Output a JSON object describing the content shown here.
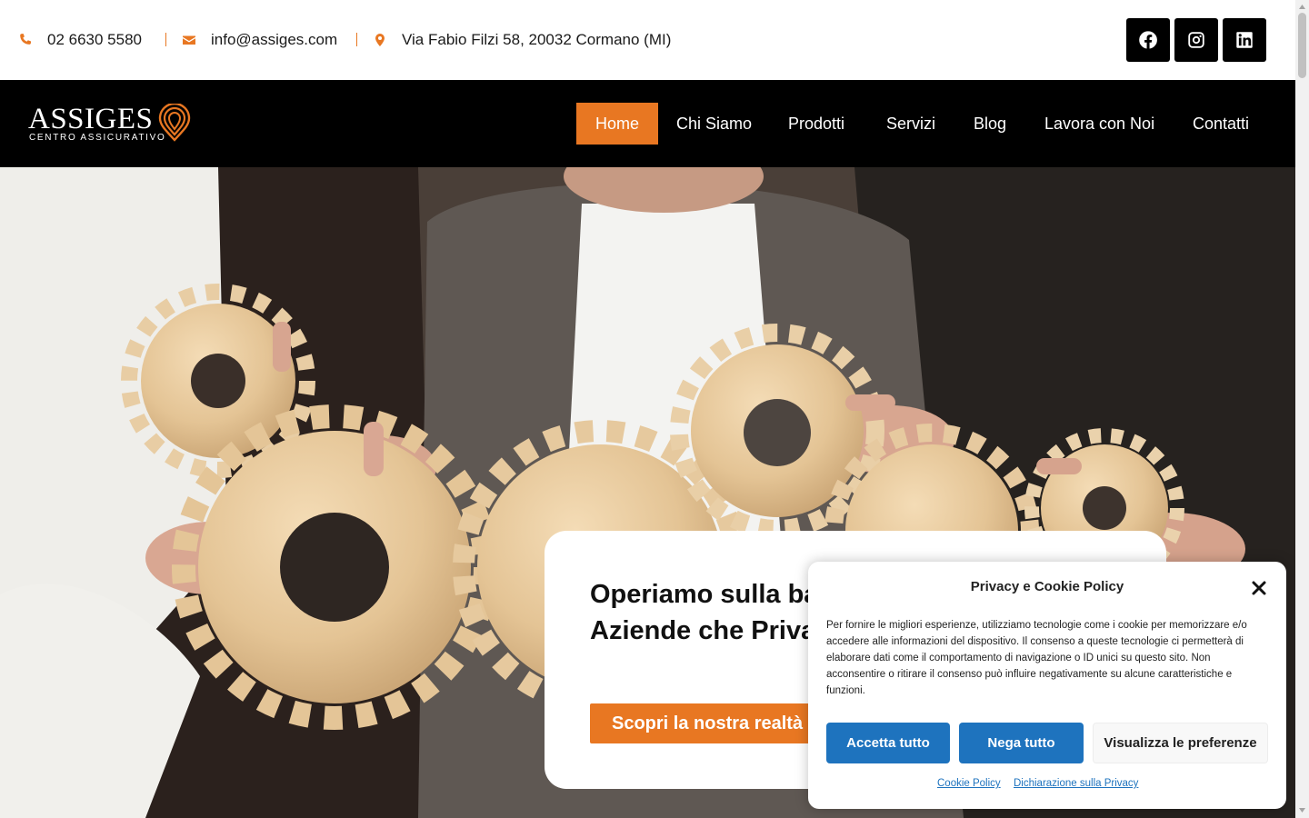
{
  "topbar": {
    "phone": "02 6630 5580",
    "email": "info@assiges.com",
    "address": "Via Fabio Filzi 58, 20032 Cormano (MI)",
    "icons": [
      "phone-icon",
      "envelope-icon",
      "map-marker-icon"
    ],
    "social": [
      "facebook-icon",
      "instagram-icon",
      "linkedin-icon"
    ]
  },
  "logo": {
    "word": "ASSIGES",
    "subtitle": "CENTRO ASSICURATIVO"
  },
  "nav": {
    "items": [
      {
        "label": "Home",
        "active": true
      },
      {
        "label": "Chi Siamo"
      },
      {
        "label": "Prodotti"
      },
      {
        "label": "Servizi"
      },
      {
        "label": "Blog"
      },
      {
        "label": "Lavora con Noi"
      },
      {
        "label": "Contatti"
      }
    ]
  },
  "hero": {
    "title": "Operiamo sulla base dei bisogni specifici di Aziende che Privati",
    "cta": "Scopri la nostra realtà"
  },
  "cookie": {
    "title": "Privacy e Cookie Policy",
    "text": "Per fornire le migliori esperienze, utilizziamo tecnologie come i cookie per memorizzare e/o accedere alle informazioni del dispositivo. Il consenso a queste tecnologie ci permetterà di elaborare dati come il comportamento di navigazione o ID unici su questo sito. Non acconsentire o ritirare il consenso può influire negativamente su alcune caratteristiche e funzioni.",
    "accept": "Accetta tutto",
    "deny": "Nega tutto",
    "preferences": "Visualizza le preferenze",
    "link_cookie": "Cookie Policy",
    "link_privacy": "Dichiarazione sulla Privacy"
  },
  "colors": {
    "accent": "#e87722",
    "navbar": "#000000",
    "cookie_button": "#1e73be"
  }
}
